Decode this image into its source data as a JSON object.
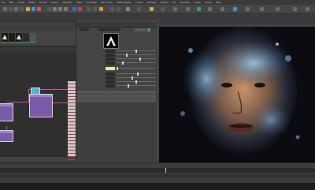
{
  "menu": [
    "File",
    "Edit",
    "Create",
    "Select",
    "Modify",
    "Display",
    "Windows",
    "Mesh",
    "Edit Mesh",
    "Mesh Tools",
    "Mesh Display",
    "Curves",
    "Surfaces",
    "Deform",
    "UV",
    "Generate",
    "Cache",
    "Arnold",
    "Help"
  ],
  "toolbar_icons": [
    "select-tool-icon",
    "move-tool-icon",
    "rotate-tool-icon",
    "scale-tool-icon",
    "snap-grid-icon",
    "render-icon",
    "ipr-render-icon",
    "render-settings-icon",
    "hypershade-icon"
  ],
  "shelf_thumbs": [
    "texture-thumb-1",
    "texture-thumb-2",
    "texture-thumb-3",
    "texture-thumb-4",
    "texture-thumb-5"
  ],
  "colors": {
    "accent_green": "#3fa34d",
    "node_purple": "#7b5aa7",
    "wire_pink": "#c94fb0",
    "swatch_cream": "#f0e6a8"
  },
  "attribute_editor": {
    "rows": [
      {
        "value": 0.5
      },
      {
        "value": 0.25
      },
      {
        "value": 0.6
      },
      {
        "value": 0.15
      },
      {
        "value": 0.0
      },
      {
        "value": 0.55
      },
      {
        "value": 0.4
      },
      {
        "value": 0.5
      },
      {
        "value": 0.3
      }
    ]
  },
  "viewport": {
    "subject": "portrait-render"
  }
}
